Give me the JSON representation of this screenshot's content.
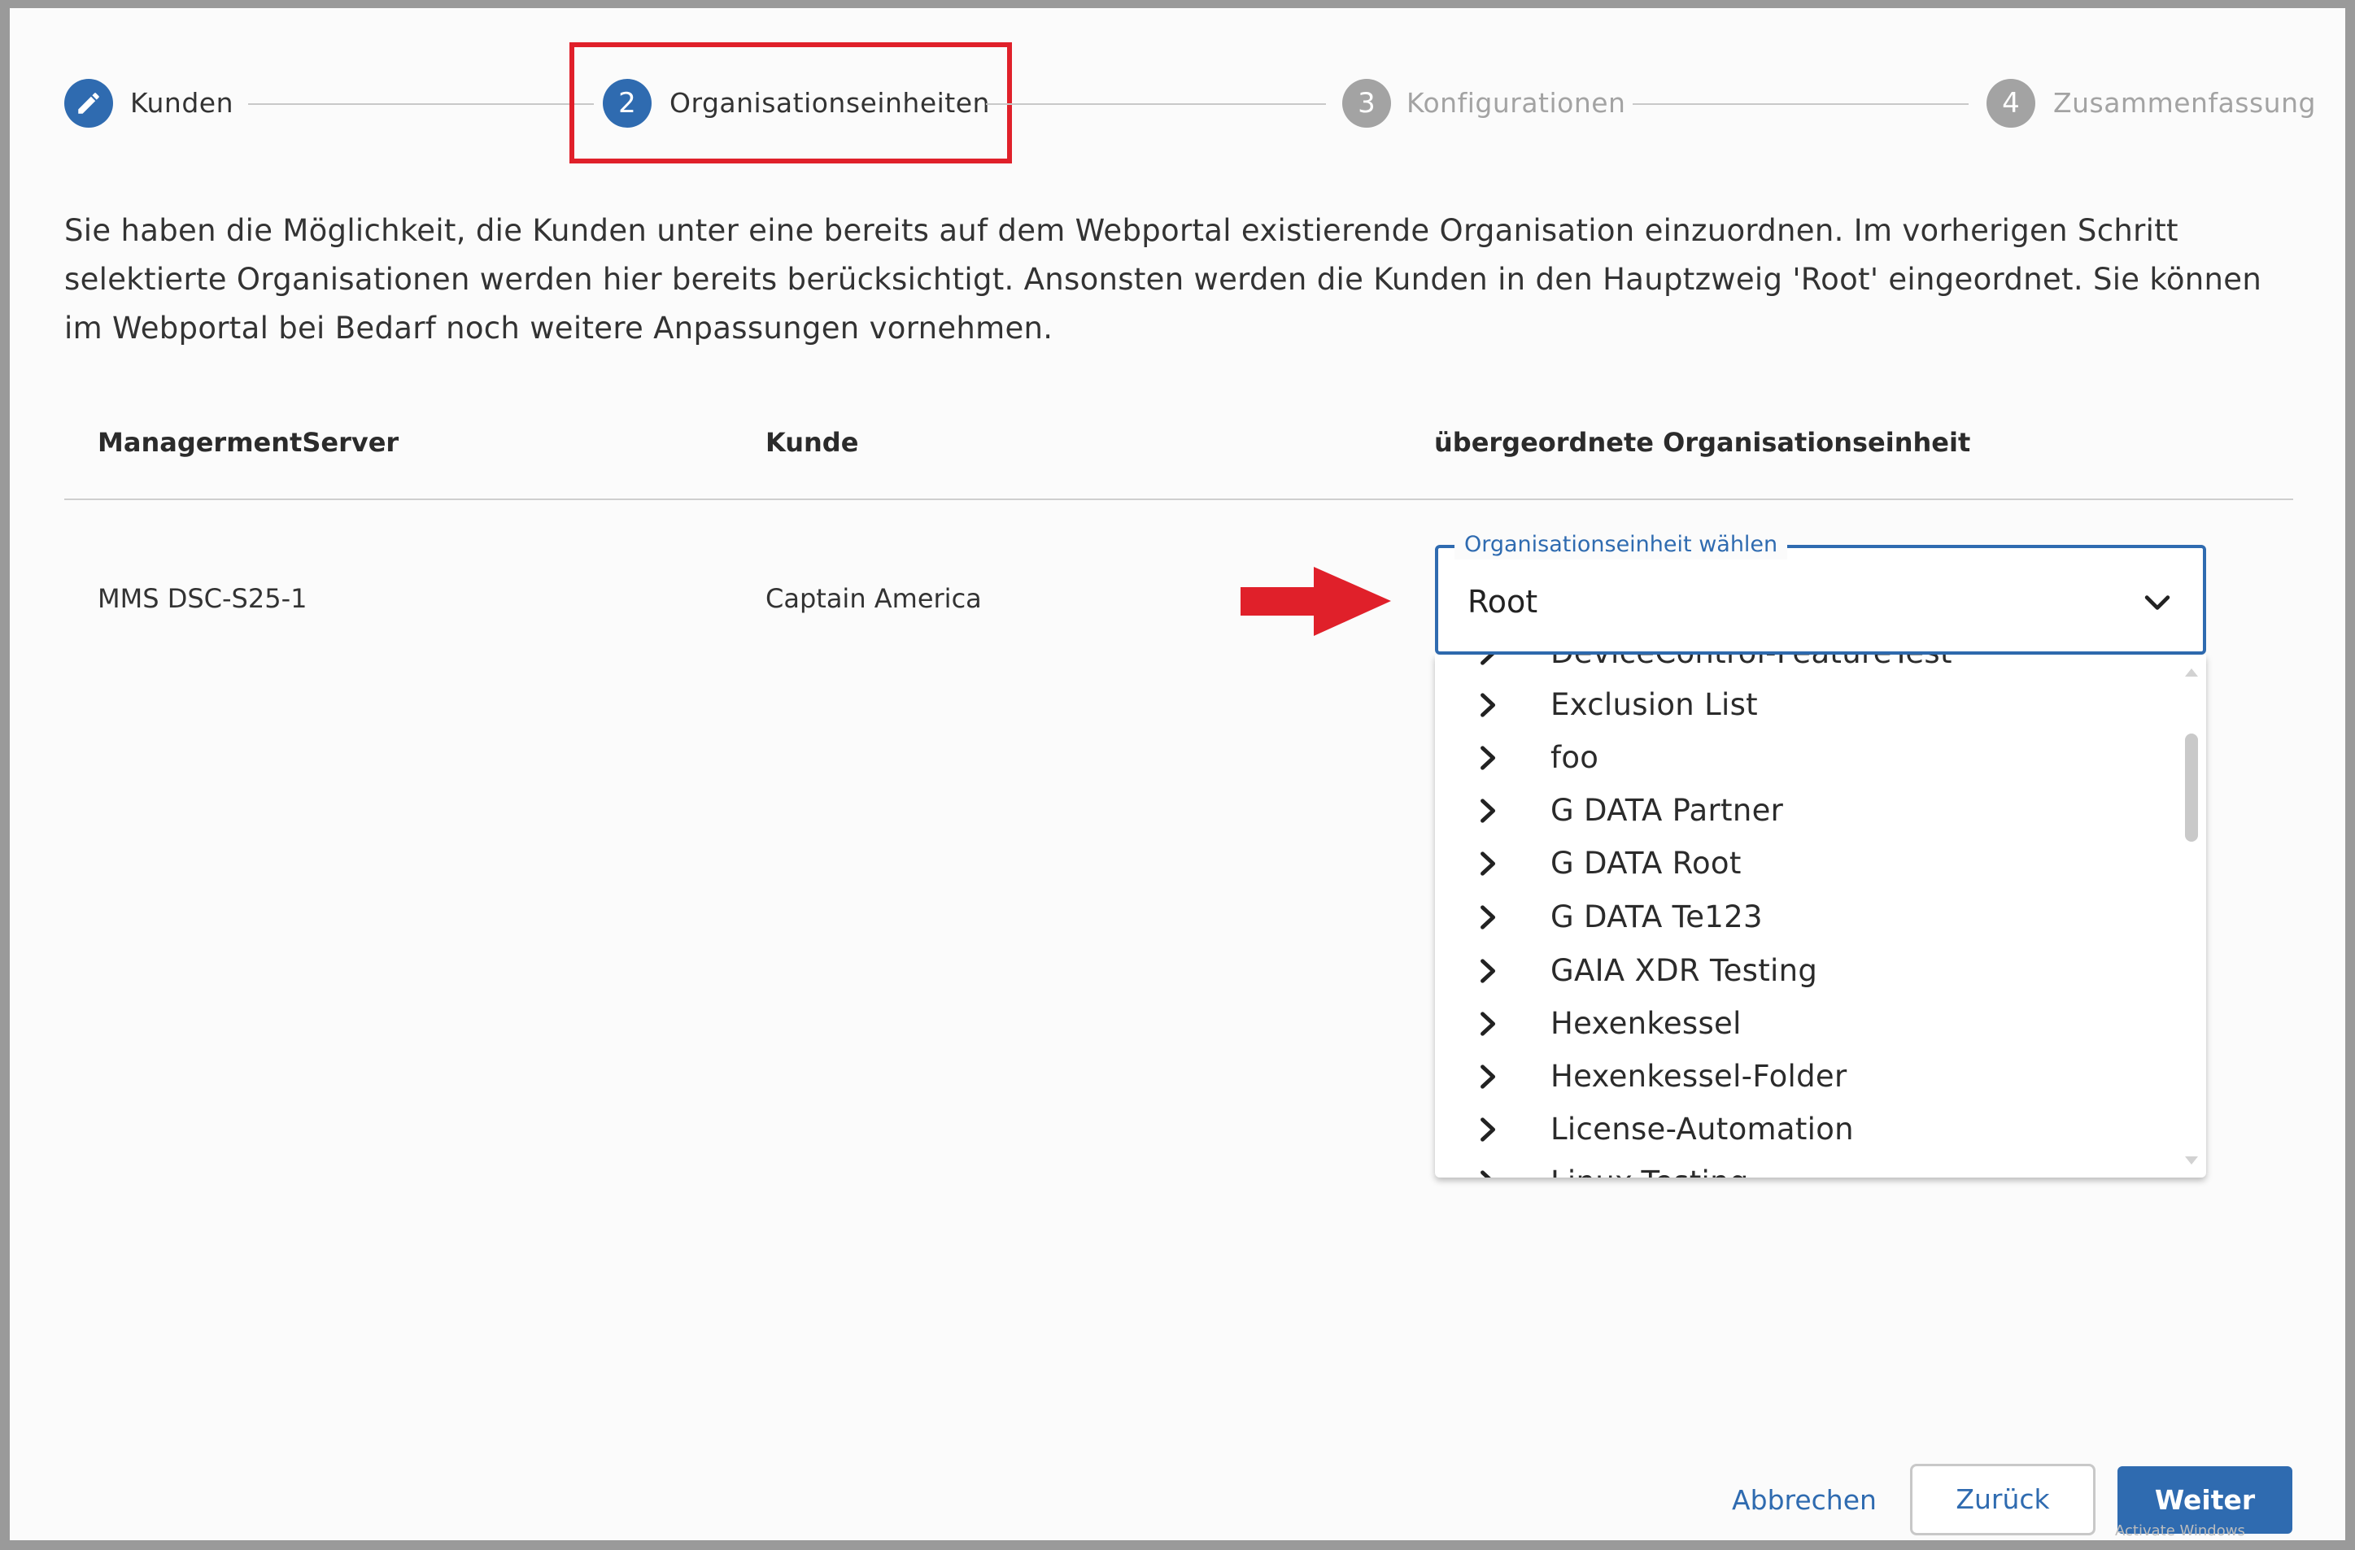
{
  "stepper": {
    "steps": [
      {
        "number": "",
        "label": "Kunden",
        "state": "done",
        "icon": "pencil-icon"
      },
      {
        "number": "2",
        "label": "Organisationseinheiten",
        "state": "active"
      },
      {
        "number": "3",
        "label": "Konfigurationen",
        "state": "inactive"
      },
      {
        "number": "4",
        "label": "Zusammenfassung",
        "state": "inactive"
      }
    ]
  },
  "description": "Sie haben die Möglichkeit, die Kunden unter eine bereits auf dem Webportal existierende Organisation einzuordnen. Im vorherigen Schritt selektierte Organisationen werden hier bereits berücksichtigt. Ansonsten werden die Kunden in den Hauptzweig 'Root' eingeordnet. Sie können im Webportal bei Bedarf noch weitere Anpassungen vornehmen.",
  "table": {
    "headers": [
      "ManagermentServer",
      "Kunde",
      "übergeordnete Organisationseinheit"
    ],
    "rows": [
      {
        "server": "MMS DSC-S25-1",
        "kunde": "Captain America"
      }
    ]
  },
  "select": {
    "legend": "Organisationseinheit wählen",
    "value": "Root"
  },
  "dropdown": {
    "items": [
      "DeviceControl-FeatureTest",
      "Exclusion List",
      "foo",
      "G DATA Partner",
      "G DATA Root",
      "G DATA Te123",
      "GAIA XDR Testing",
      "Hexenkessel",
      "Hexenkessel-Folder",
      "License-Automation",
      "Linux-Testing"
    ]
  },
  "buttons": {
    "cancel": "Abbrechen",
    "back": "Zurück",
    "next": "Weiter"
  },
  "watermark": "Activate Windows",
  "colors": {
    "accent": "#2f6bb0",
    "highlight": "#e0202a",
    "inactive": "#a3a3a3"
  }
}
